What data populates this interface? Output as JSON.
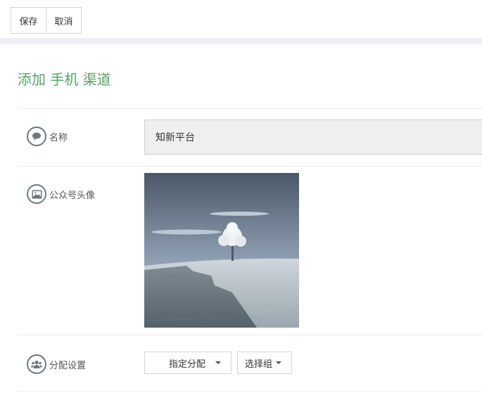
{
  "toolbar": {
    "save_label": "保存",
    "cancel_label": "取消"
  },
  "page": {
    "title": "添加 手机 渠道"
  },
  "form": {
    "name": {
      "label": "名称",
      "value": "知新平台"
    },
    "avatar": {
      "label": "公众号头像"
    },
    "assign": {
      "label": "分配设置",
      "mode_value": "指定分配",
      "group_label": "选择组"
    }
  },
  "icons": {
    "name": "chat-bubble-icon",
    "avatar": "image-icon",
    "assign": "users-icon"
  },
  "colors": {
    "accent": "#52a567",
    "band": "#eef0f6"
  }
}
